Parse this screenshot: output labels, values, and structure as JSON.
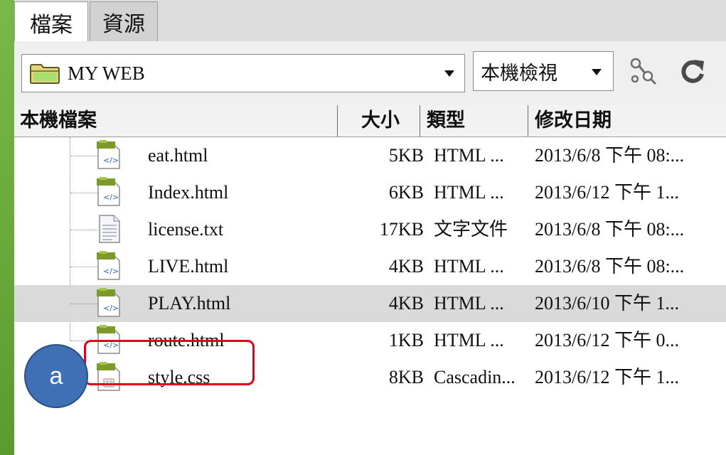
{
  "tabs": [
    {
      "label": "檔案"
    },
    {
      "label": "資源"
    }
  ],
  "toolbar": {
    "site": "MY WEB",
    "view": "本機檢視",
    "icons": [
      "connect-icon",
      "refresh-icon"
    ]
  },
  "columns": {
    "name": "本機檔案",
    "size": "大小",
    "type": "類型",
    "modified": "修改日期"
  },
  "files": [
    {
      "name": "eat.html",
      "size": "5KB",
      "type": "HTML ...",
      "modified": "2013/6/8 下午 08:...",
      "icon": "html-file-icon"
    },
    {
      "name": "Index.html",
      "size": "6KB",
      "type": "HTML ...",
      "modified": "2013/6/12 下午 1...",
      "icon": "html-file-icon"
    },
    {
      "name": "license.txt",
      "size": "17KB",
      "type": "文字文件",
      "modified": "2013/6/8 下午 08:...",
      "icon": "text-file-icon"
    },
    {
      "name": "LIVE.html",
      "size": "4KB",
      "type": "HTML ...",
      "modified": "2013/6/8 下午 08:...",
      "icon": "html-file-icon"
    },
    {
      "name": "PLAY.html",
      "size": "4KB",
      "type": "HTML ...",
      "modified": "2013/6/10 下午 1...",
      "icon": "html-file-icon",
      "selected": true
    },
    {
      "name": "route.html",
      "size": "1KB",
      "type": "HTML ...",
      "modified": "2013/6/12 下午 0...",
      "icon": "html-file-icon"
    },
    {
      "name": "style.css",
      "size": "8KB",
      "type": "Cascadin...",
      "modified": "2013/6/12 下午 1...",
      "icon": "css-file-icon"
    }
  ],
  "annotation": {
    "badge": "a"
  },
  "colors": {
    "highlight": "#e0001b",
    "badge": "#3f6fb5",
    "selected_row": "#dadada"
  }
}
